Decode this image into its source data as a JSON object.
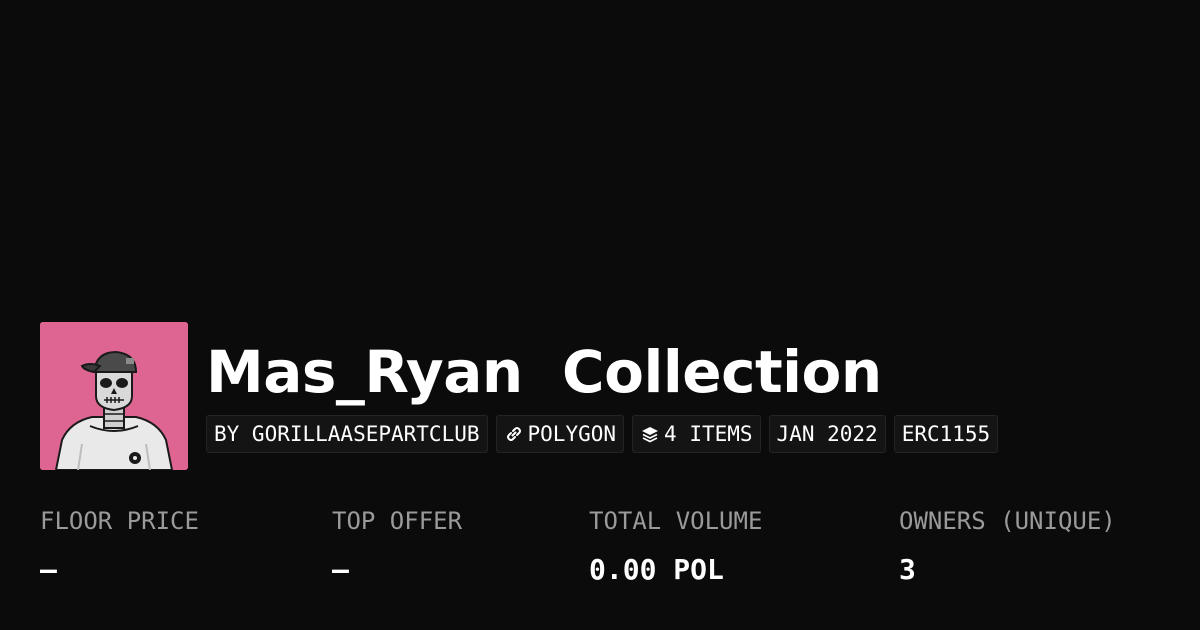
{
  "collection": {
    "title": "Mas_Ryan  Collection",
    "avatar_bg_color": "#de6592"
  },
  "tags": [
    {
      "text": "BY GORILLAASEPARTCLUB",
      "icon": null
    },
    {
      "text": "POLYGON",
      "icon": "chain-link-icon"
    },
    {
      "text": "4 ITEMS",
      "icon": "layers-icon"
    },
    {
      "text": "JAN 2022",
      "icon": null
    },
    {
      "text": "ERC1155",
      "icon": null
    }
  ],
  "stats": [
    {
      "label": "FLOOR PRICE",
      "value": "–"
    },
    {
      "label": "TOP OFFER",
      "value": "–"
    },
    {
      "label": "TOTAL VOLUME",
      "value": "0.00 POL"
    },
    {
      "label": "OWNERS (UNIQUE)",
      "value": "3"
    }
  ],
  "colors": {
    "background": "#0b0b0b",
    "text": "#ffffff",
    "muted": "#9a9a9a",
    "tag_bg": "#141414"
  }
}
